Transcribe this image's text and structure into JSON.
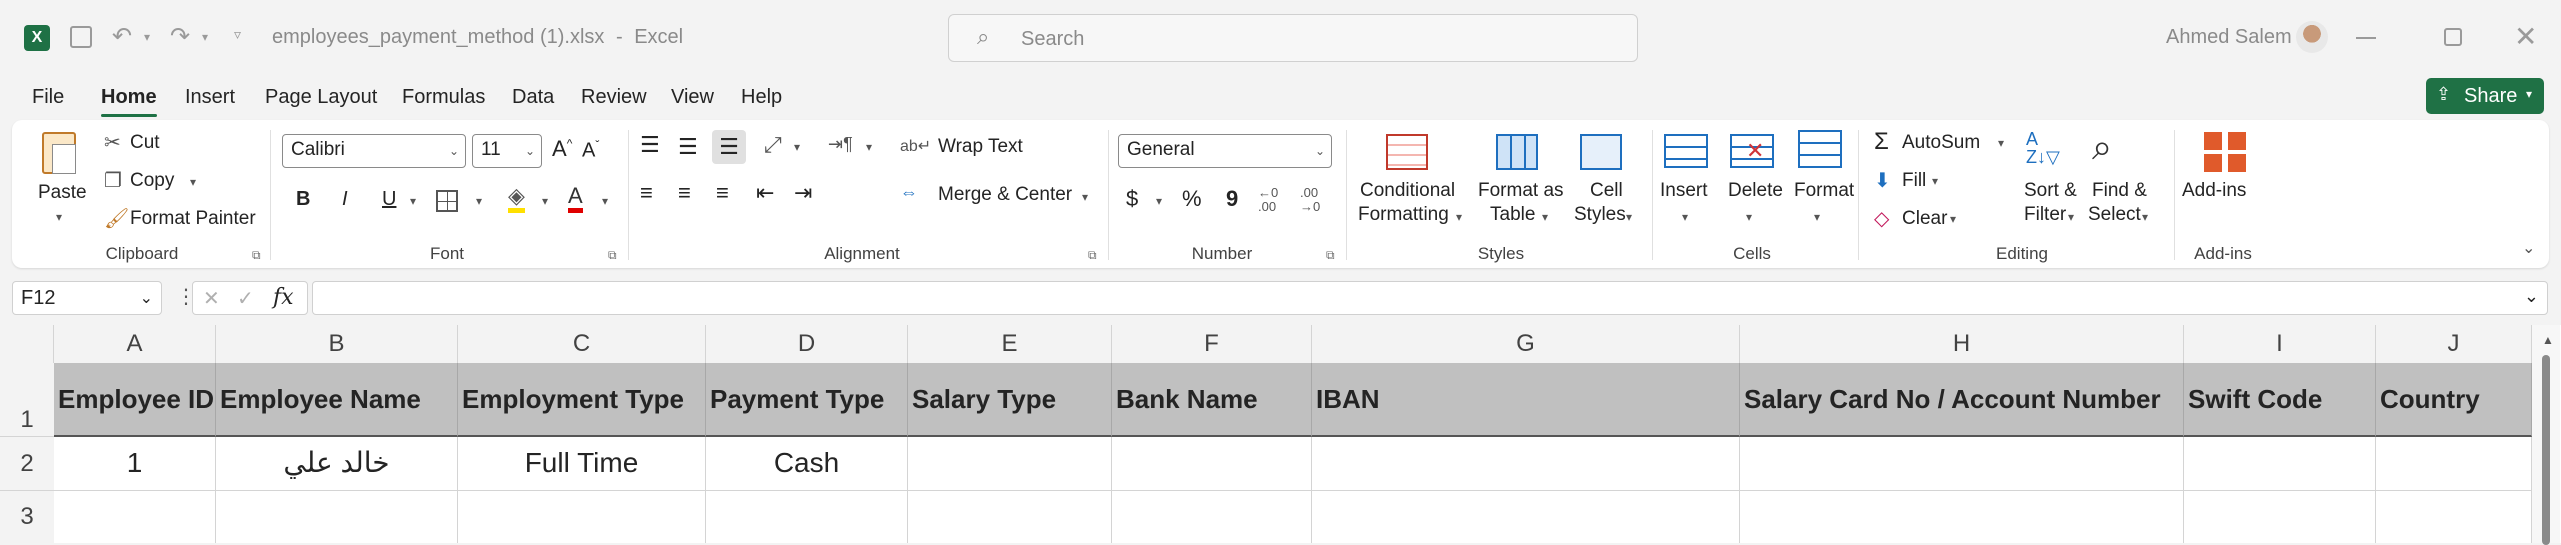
{
  "titlebar": {
    "filename": "employees_payment_method (1).xlsx",
    "separator": "-",
    "app": "Excel",
    "search_placeholder": "Search",
    "user_name": "Ahmed Salem",
    "icons": [
      "excel-logo-icon",
      "save-icon",
      "undo-icon",
      "redo-icon",
      "customize-qat-icon",
      "search-icon",
      "minimize-icon",
      "restore-icon",
      "close-icon"
    ]
  },
  "menu": {
    "tabs": [
      "File",
      "Home",
      "Insert",
      "Page Layout",
      "Formulas",
      "Data",
      "Review",
      "View",
      "Help"
    ],
    "active_tab": "Home",
    "share_label": "Share"
  },
  "ribbon": {
    "clipboard": {
      "paste": "Paste",
      "cut": "Cut",
      "copy": "Copy",
      "format_painter": "Format Painter",
      "group": "Clipboard"
    },
    "font": {
      "font_name": "Calibri",
      "font_size": "11",
      "bold": "B",
      "italic": "I",
      "underline": "U",
      "group": "Font"
    },
    "alignment": {
      "wrap_text": "Wrap Text",
      "merge_center": "Merge & Center",
      "group": "Alignment"
    },
    "number": {
      "format": "General",
      "currency": "$",
      "percent": "%",
      "comma": "9",
      "group": "Number"
    },
    "styles": {
      "conditional": "Conditional",
      "formatting": "Formatting",
      "format_as": "Format as",
      "table": "Table",
      "cell": "Cell",
      "styles_lbl": "Styles",
      "group": "Styles"
    },
    "cells": {
      "insert": "Insert",
      "delete": "Delete",
      "format": "Format",
      "group": "Cells"
    },
    "editing": {
      "autosum": "AutoSum",
      "fill": "Fill",
      "clear": "Clear",
      "sort": "Sort &",
      "filter": "Filter",
      "find": "Find &",
      "select": "Select",
      "group": "Editing"
    },
    "addins": {
      "addins": "Add-ins",
      "group": "Add-ins"
    }
  },
  "formula_bar": {
    "name_box": "F12",
    "fx": "fx",
    "formula": ""
  },
  "sheet": {
    "columns": [
      "A",
      "B",
      "C",
      "D",
      "E",
      "F",
      "G",
      "H",
      "I",
      "J"
    ],
    "rows": [
      "1",
      "2",
      "3"
    ],
    "headers": [
      "Employee ID",
      "Employee Name",
      "Employment Type",
      "Payment Type",
      "Salary Type",
      "Bank Name",
      "IBAN",
      "Salary Card No / Account Number",
      "Swift Code",
      "Country"
    ],
    "row2": [
      "1",
      "خالد علي",
      "Full Time",
      "Cash",
      "",
      "",
      "",
      "",
      "",
      ""
    ]
  },
  "colors": {
    "excel_green": "#1e7145",
    "share_green": "#1f7145",
    "header_fill": "#c0c0c0"
  }
}
